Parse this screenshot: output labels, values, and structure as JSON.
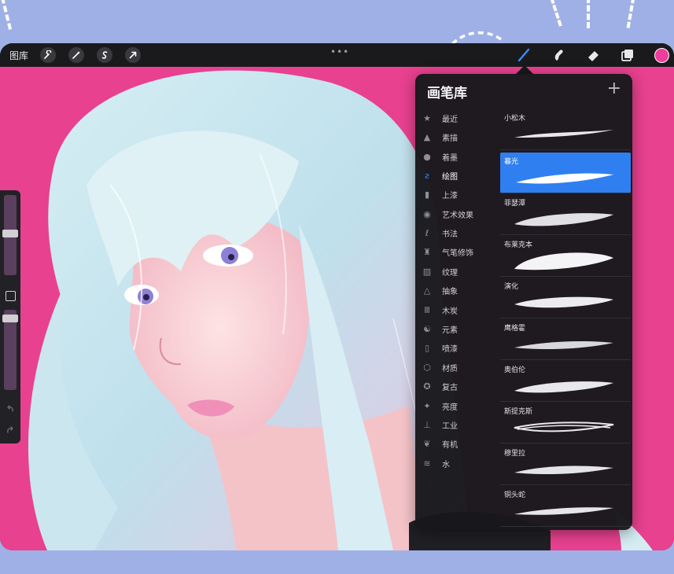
{
  "toolbar": {
    "gallery": "图库",
    "icons": [
      "wrench-icon",
      "magic-wand-icon",
      "selection-icon",
      "transform-arrow-icon",
      "brush-icon",
      "smudge-icon",
      "eraser-icon",
      "layers-icon"
    ],
    "more": "•••",
    "active_color": "#ee3d9c"
  },
  "brush_library": {
    "title": "画笔库",
    "add": "+",
    "categories": [
      {
        "label": "最近",
        "icon": "star-icon"
      },
      {
        "label": "素描",
        "icon": "pencil-tip-icon"
      },
      {
        "label": "着墨",
        "icon": "ink-drop-icon"
      },
      {
        "label": "绘图",
        "icon": "drawing-icon",
        "selected": true
      },
      {
        "label": "上漆",
        "icon": "paint-brush-icon"
      },
      {
        "label": "艺术效果",
        "icon": "palette-icon"
      },
      {
        "label": "书法",
        "icon": "calligraphy-icon"
      },
      {
        "label": "气笔修饰",
        "icon": "airbrush-icon"
      },
      {
        "label": "纹理",
        "icon": "texture-icon"
      },
      {
        "label": "抽象",
        "icon": "triangle-icon"
      },
      {
        "label": "木炭",
        "icon": "charcoal-icon"
      },
      {
        "label": "元素",
        "icon": "yin-yang-icon"
      },
      {
        "label": "喷漆",
        "icon": "spray-can-icon"
      },
      {
        "label": "材质",
        "icon": "cube-icon"
      },
      {
        "label": "复古",
        "icon": "retro-badge-icon"
      },
      {
        "label": "亮度",
        "icon": "sparkle-icon"
      },
      {
        "label": "工业",
        "icon": "anvil-icon"
      },
      {
        "label": "有机",
        "icon": "leaf-icon"
      },
      {
        "label": "水",
        "icon": "water-waves-icon"
      }
    ],
    "brushes": [
      {
        "name": "小松木"
      },
      {
        "name": "暮光",
        "selected": true
      },
      {
        "name": "菲瑟潭"
      },
      {
        "name": "布莱克本"
      },
      {
        "name": "演化"
      },
      {
        "name": "鹰格霍"
      },
      {
        "name": "奥伯伦"
      },
      {
        "name": "斯提克斯"
      },
      {
        "name": "穆里拉"
      },
      {
        "name": "铜头蛇"
      }
    ]
  },
  "colors": {
    "accent_blue": "#2f7ff0",
    "canvas_pink": "#e8418f",
    "background": "#9fb0e6"
  }
}
